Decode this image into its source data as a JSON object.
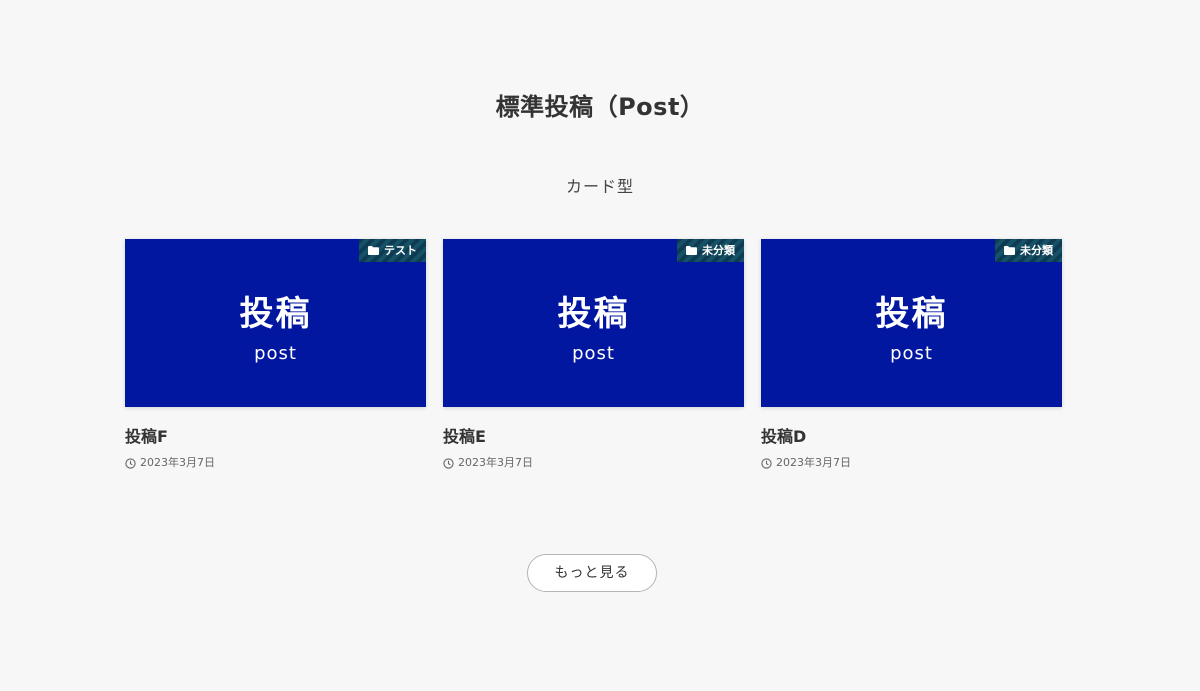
{
  "section": {
    "title": "標準投稿（Post）",
    "subtitle": "カード型"
  },
  "cards": [
    {
      "thumbnail_main": "投稿",
      "thumbnail_sub": "post",
      "category": "テスト",
      "title": "投稿F",
      "date": "2023年3月7日"
    },
    {
      "thumbnail_main": "投稿",
      "thumbnail_sub": "post",
      "category": "未分類",
      "title": "投稿E",
      "date": "2023年3月7日"
    },
    {
      "thumbnail_main": "投稿",
      "thumbnail_sub": "post",
      "category": "未分類",
      "title": "投稿D",
      "date": "2023年3月7日"
    }
  ],
  "more_button": {
    "label": "もっと見る"
  },
  "colors": {
    "background": "#f7f7f7",
    "thumbnail_bg": "#0217a0",
    "badge_bg": "#0f3b52",
    "text": "#333333"
  },
  "icons": {
    "category": "folder-icon",
    "date": "clock-icon"
  }
}
